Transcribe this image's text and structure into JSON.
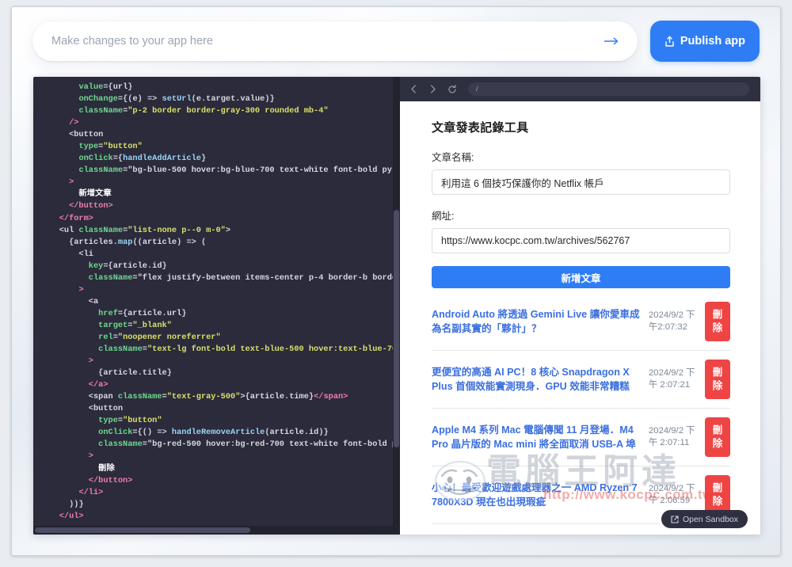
{
  "topbar": {
    "prompt_placeholder": "Make changes to your app here",
    "prompt_value": "",
    "submit_icon": "arrow-right-icon",
    "publish_label": "Publish app",
    "publish_icon": "upload-icon",
    "accent_color": "#2f7df4"
  },
  "editor": {
    "theme_bg": "#2b2b3c",
    "code": "        value={url}\n        onChange={(e) => setUrl(e.target.value)}\n        className=\"p-2 border border-gray-300 rounded mb-4\"\n      />\n      <button\n        type=\"button\"\n        onClick={handleAddArticle}\n        className=\"bg-blue-500 hover:bg-blue-700 text-white font-bold py-2 px-4 rou\n      >\n        新增文章\n      </button>\n    </form>\n    <ul className=\"list-none p--0 m-0\">\n      {articles.map((article) => (\n        <li\n          key={article.id}\n          className=\"flex justify-between items-center p-4 border-b border-gray-300\n        >\n          <a\n            href={article.url}\n            target=\"_blank\"\n            rel=\"noopener noreferrer\"\n            className=\"text-lg font-bold text-blue-500 hover:text-blue-700\"\n          >\n            {article.title}\n          </a>\n          <span className=\"text-gray-500\">{article.time}</span>\n          <button\n            type=\"button\"\n            onClick={() => handleRemoveArticle(article.id)}\n            className=\"bg-red-500 hover:bg-red-700 text-white font-bold py-2 px-4 r\n          >\n            刪除\n          </button>\n        </li>\n      ))}\n    </ul>\n  </div>\n  );\n};"
  },
  "browser": {
    "back_icon": "chevron-left-icon",
    "forward_icon": "chevron-right-icon",
    "reload_icon": "reload-icon",
    "url": "/"
  },
  "preview": {
    "app_title": "文章發表記錄工具",
    "title_label": "文章名稱:",
    "title_value": "利用這 6 個技巧保護你的 Netflix 帳戶",
    "url_label": "網址:",
    "url_value": "https://www.kocpc.com.tw/archives/562767",
    "add_button_label": "新增文章",
    "remove_button_label": "刪除",
    "link_color": "#3b6fe0",
    "danger_color": "#ef4444",
    "articles": [
      {
        "title": "Android Auto 將透過 Gemini Live 讓你愛車成為名副其實的「夥計」？",
        "time": "2024/9/2 下午2:07:32"
      },
      {
        "title": "更便宜的高通 AI PC！8 核心 Snapdragon X Plus 首個效能實測現身．GPU 效能非常糟糕",
        "time": "2024/9/2 下午 2:07:21"
      },
      {
        "title": "Apple M4 系列 Mac 電腦傳聞 11 月登場．M4 Pro 晶片版的 Mac mini 將全面取消 USB-A 埠",
        "time": "2024/9/2 下午 2:07:11"
      },
      {
        "title": "小心！最受歡迎遊戲處理器之一 AMD Ryzen 7 7800X3D 現在也出現瑕疵",
        "time": "2024/9/2 下午 2:06:59"
      }
    ]
  },
  "watermark": {
    "text": "電腦王阿達",
    "url": "http://www.kocpc.com.tw"
  },
  "sandbox": {
    "label": "Open Sandbox",
    "icon": "external-link-icon"
  }
}
